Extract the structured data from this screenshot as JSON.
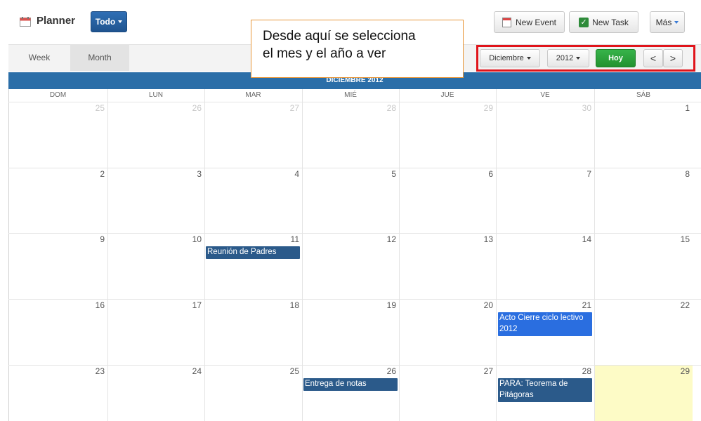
{
  "header": {
    "title": "Planner",
    "filter_label": "Todo",
    "new_event_label": "New Event",
    "new_task_label": "New Task",
    "mas_label": "Más"
  },
  "tabs": {
    "week": "Week",
    "month": "Month"
  },
  "nav": {
    "month_select": "Diciembre",
    "year_select": "2012",
    "today_label": "Hoy",
    "prev_symbol": "<",
    "next_symbol": ">"
  },
  "callout": {
    "line1": "Desde aquí se selecciona",
    "line2": "el mes y el año a ver"
  },
  "calendar": {
    "month_title": "DICIEMBRE 2012",
    "weekdays": [
      "DOM",
      "LUN",
      "MAR",
      "MIÉ",
      "JUE",
      "VE",
      "SÁB"
    ],
    "weeks": [
      [
        "25",
        "26",
        "27",
        "28",
        "29",
        "30",
        "1"
      ],
      [
        "2",
        "3",
        "4",
        "5",
        "6",
        "7",
        "8"
      ],
      [
        "9",
        "10",
        "11",
        "12",
        "13",
        "14",
        "15"
      ],
      [
        "16",
        "17",
        "18",
        "19",
        "20",
        "21",
        "22"
      ],
      [
        "23",
        "24",
        "25",
        "26",
        "27",
        "28",
        "29"
      ]
    ],
    "events": [
      {
        "title": "Reunión de Padres",
        "day": "11"
      },
      {
        "title": "Acto Cierre ciclo lectivo 2012",
        "day": "21"
      },
      {
        "title": "Entrega de notas",
        "day": "26"
      },
      {
        "title": "PARA: Teorema de Pitágoras",
        "day": "28"
      }
    ]
  },
  "colors": {
    "accent": "#2b6ea8",
    "today_bg": "#fdfbc6",
    "highlight_border": "#e0141b",
    "hoy_button": "#2ea33e"
  }
}
